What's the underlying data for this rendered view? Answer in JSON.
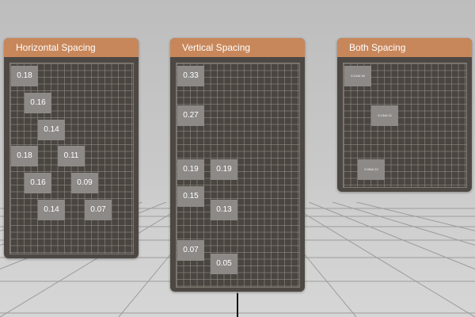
{
  "colors": {
    "header": "#c8875a",
    "panel": "#4d4843",
    "tile": "#8c8986",
    "grid_line": "#969189"
  },
  "panels": [
    {
      "title": "Horizontal Spacing",
      "tiles": [
        "0.18",
        "0.16",
        "0.14",
        "0.18",
        "0.11",
        "0.16",
        "0.09",
        "0.14",
        "0.07"
      ]
    },
    {
      "title": "Vertical Spacing",
      "tiles": [
        "0.33",
        "0.27",
        "0.19",
        "0.19",
        "0.15",
        "0.13",
        "0.07",
        "0.05"
      ]
    },
    {
      "title": "Both Spacing",
      "tiles": [
        "0.12x0.16",
        "0.13x0.12",
        "0.09x0.12"
      ]
    }
  ]
}
